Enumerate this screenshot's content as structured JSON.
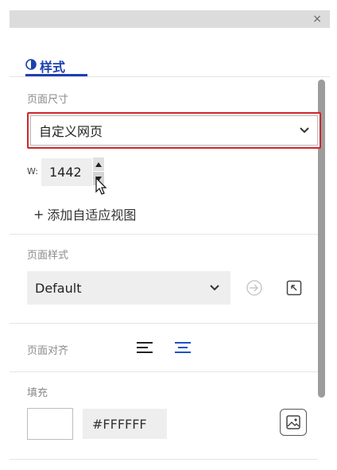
{
  "window": {
    "close_label": "×"
  },
  "tab": {
    "label": "样式",
    "icon": "palette-icon",
    "color": "#1e3fb0"
  },
  "page_size": {
    "label": "页面尺寸",
    "select_value": "自定义网页",
    "width_label": "W:",
    "width_value": "1442",
    "add_view_plus": "+",
    "add_view_label": "添加自适应视图"
  },
  "page_style": {
    "label": "页面样式",
    "select_value": "Default"
  },
  "page_align": {
    "label": "页面对齐",
    "active_color": "#1e50c8"
  },
  "fill": {
    "label": "填充",
    "color_value": "#FFFFFF"
  },
  "colors": {
    "highlight_border": "#d0262c"
  }
}
